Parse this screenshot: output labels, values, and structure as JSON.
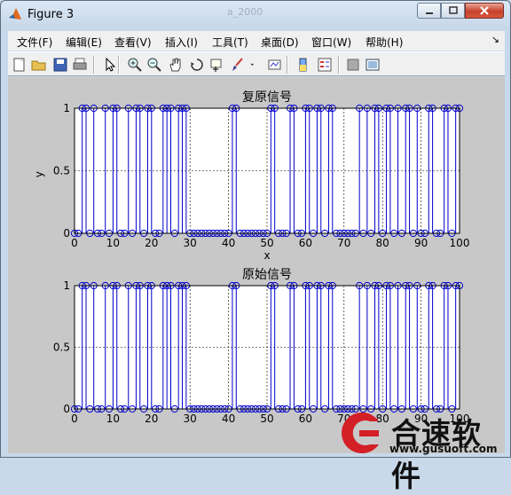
{
  "window": {
    "title": "Figure 3",
    "background_ghost_text": "a_2000"
  },
  "menus": [
    "文件(F)",
    "编辑(E)",
    "查看(V)",
    "插入(I)",
    "工具(T)",
    "桌面(D)",
    "窗口(W)",
    "帮助(H)"
  ],
  "toolbar_icons": [
    "new-figure-icon",
    "open-file-icon",
    "save-icon",
    "print-icon",
    "pointer-icon",
    "zoom-in-icon",
    "zoom-out-icon",
    "pan-hand-icon",
    "rotate-3d-icon",
    "data-cursor-icon",
    "brush-icon",
    "brush-dropdown-icon",
    "link-plot-icon",
    "colorbar-icon",
    "legend-icon",
    "hide-plot-tools-icon",
    "show-plot-tools-icon"
  ],
  "chart_data": [
    {
      "type": "stem",
      "title": "复原信号",
      "xlabel": "x",
      "ylabel": "y",
      "xlim": [
        0,
        100
      ],
      "ylim": [
        0,
        1
      ],
      "xticks": [
        "0",
        "10",
        "20",
        "30",
        "40",
        "50",
        "60",
        "70",
        "80",
        "90",
        "100"
      ],
      "yticks": [
        "0",
        "0.5",
        "1"
      ],
      "grid": true,
      "marker": "circle",
      "color": "#0000cc",
      "x": [
        0,
        1,
        2,
        3,
        4,
        5,
        6,
        7,
        8,
        9,
        10,
        11,
        12,
        13,
        14,
        15,
        16,
        17,
        18,
        19,
        20,
        21,
        22,
        23,
        24,
        25,
        26,
        27,
        28,
        29,
        30,
        31,
        32,
        33,
        34,
        35,
        36,
        37,
        38,
        39,
        40,
        41,
        42,
        43,
        44,
        45,
        46,
        47,
        48,
        49,
        50,
        51,
        52,
        53,
        54,
        55,
        56,
        57,
        58,
        59,
        60,
        61,
        62,
        63,
        64,
        65,
        66,
        67,
        68,
        69,
        70,
        71,
        72,
        73,
        74,
        75,
        76,
        77,
        78,
        79,
        80,
        81,
        82,
        83,
        84,
        85,
        86,
        87,
        88,
        89,
        90,
        91,
        92,
        93,
        94,
        95,
        96,
        97,
        98,
        99,
        100
      ],
      "values": [
        0,
        0,
        1,
        1,
        0,
        1,
        0,
        0,
        1,
        0,
        1,
        1,
        0,
        0,
        1,
        0,
        1,
        1,
        0,
        1,
        1,
        0,
        0,
        1,
        1,
        1,
        0,
        1,
        1,
        1,
        0,
        0,
        0,
        0,
        0,
        0,
        0,
        0,
        0,
        0,
        0,
        1,
        1,
        0,
        0,
        0,
        0,
        0,
        0,
        0,
        0,
        1,
        1,
        0,
        0,
        0,
        1,
        1,
        0,
        0,
        1,
        1,
        0,
        1,
        1,
        0,
        1,
        1,
        0,
        0,
        0,
        0,
        0,
        0,
        1,
        0,
        1,
        0,
        1,
        1,
        0,
        1,
        1,
        0,
        1,
        0,
        1,
        1,
        0,
        1,
        0,
        0,
        1,
        1,
        0,
        0,
        1,
        1,
        0,
        1,
        1
      ]
    },
    {
      "type": "stem",
      "title": "原始信号",
      "xlim": [
        0,
        100
      ],
      "ylim": [
        0,
        1
      ],
      "xticks": [
        "0",
        "10",
        "20",
        "30",
        "40",
        "50",
        "60",
        "70",
        "80",
        "90",
        "100"
      ],
      "yticks": [
        "0",
        "0.5",
        "1"
      ],
      "grid": true,
      "marker": "circle",
      "color": "#0000cc",
      "x": [
        0,
        1,
        2,
        3,
        4,
        5,
        6,
        7,
        8,
        9,
        10,
        11,
        12,
        13,
        14,
        15,
        16,
        17,
        18,
        19,
        20,
        21,
        22,
        23,
        24,
        25,
        26,
        27,
        28,
        29,
        30,
        31,
        32,
        33,
        34,
        35,
        36,
        37,
        38,
        39,
        40,
        41,
        42,
        43,
        44,
        45,
        46,
        47,
        48,
        49,
        50,
        51,
        52,
        53,
        54,
        55,
        56,
        57,
        58,
        59,
        60,
        61,
        62,
        63,
        64,
        65,
        66,
        67,
        68,
        69,
        70,
        71,
        72,
        73,
        74,
        75,
        76,
        77,
        78,
        79,
        80,
        81,
        82,
        83,
        84,
        85,
        86,
        87,
        88,
        89,
        90,
        91,
        92,
        93,
        94,
        95,
        96,
        97,
        98,
        99,
        100
      ],
      "values": [
        0,
        0,
        1,
        1,
        0,
        1,
        0,
        0,
        1,
        0,
        1,
        1,
        0,
        0,
        1,
        0,
        1,
        1,
        0,
        1,
        1,
        0,
        0,
        1,
        1,
        1,
        0,
        1,
        1,
        1,
        0,
        0,
        0,
        0,
        0,
        0,
        0,
        0,
        0,
        0,
        0,
        1,
        1,
        0,
        0,
        0,
        0,
        0,
        0,
        0,
        0,
        1,
        1,
        0,
        0,
        0,
        1,
        1,
        0,
        0,
        1,
        1,
        0,
        1,
        1,
        0,
        1,
        1,
        0,
        0,
        0,
        0,
        0,
        0,
        1,
        0,
        1,
        0,
        1,
        1,
        0,
        1,
        1,
        0,
        1,
        0,
        1,
        1,
        0,
        1,
        0,
        0,
        1,
        1,
        0,
        0,
        1,
        1,
        0,
        1,
        1
      ]
    }
  ],
  "watermark": {
    "brand": "合速软件",
    "url": "www.gusuoft.com"
  }
}
